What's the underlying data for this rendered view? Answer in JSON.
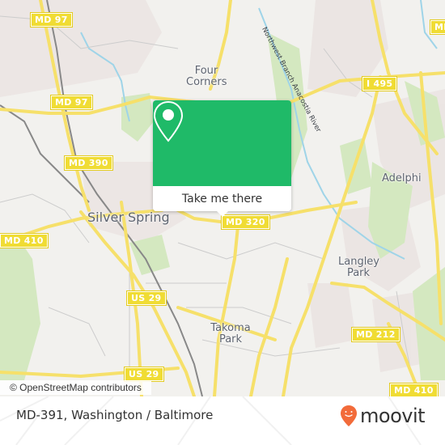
{
  "map": {
    "colors": {
      "background": "#f2f1ee",
      "road": "#f6e06a",
      "road_outline": "#f0d84a",
      "park": "#d4e8c0",
      "urban": "#ebe4e2",
      "water": "#9fd4e8",
      "rail": "#777777",
      "minor_road": "#cfcfcf"
    },
    "place_labels": [
      {
        "name": "Silver Spring"
      },
      {
        "name": "Four Corners"
      },
      {
        "name": "Adelphi"
      },
      {
        "name": "Langley Park"
      },
      {
        "name": "Takoma Park"
      }
    ],
    "river_label": "Northwest Branch Anacostia River",
    "road_shields": [
      {
        "label": "MD 97"
      },
      {
        "label": "MD 97"
      },
      {
        "label": "MD 390"
      },
      {
        "label": "MD 410"
      },
      {
        "label": "MD 320"
      },
      {
        "label": "US 29"
      },
      {
        "label": "US 29"
      },
      {
        "label": "I 495"
      },
      {
        "label": "MD 212"
      },
      {
        "label": "MD 410"
      },
      {
        "label": "MD"
      }
    ],
    "attribution": "© OpenStreetMap contributors"
  },
  "popup": {
    "button_label": "Take me there",
    "accent_color": "#1fba68",
    "icon": "map-pin-icon"
  },
  "footer": {
    "location_title": "MD-391, Washington / Baltimore",
    "brand": "moovit",
    "brand_color": "#f26b3a"
  }
}
